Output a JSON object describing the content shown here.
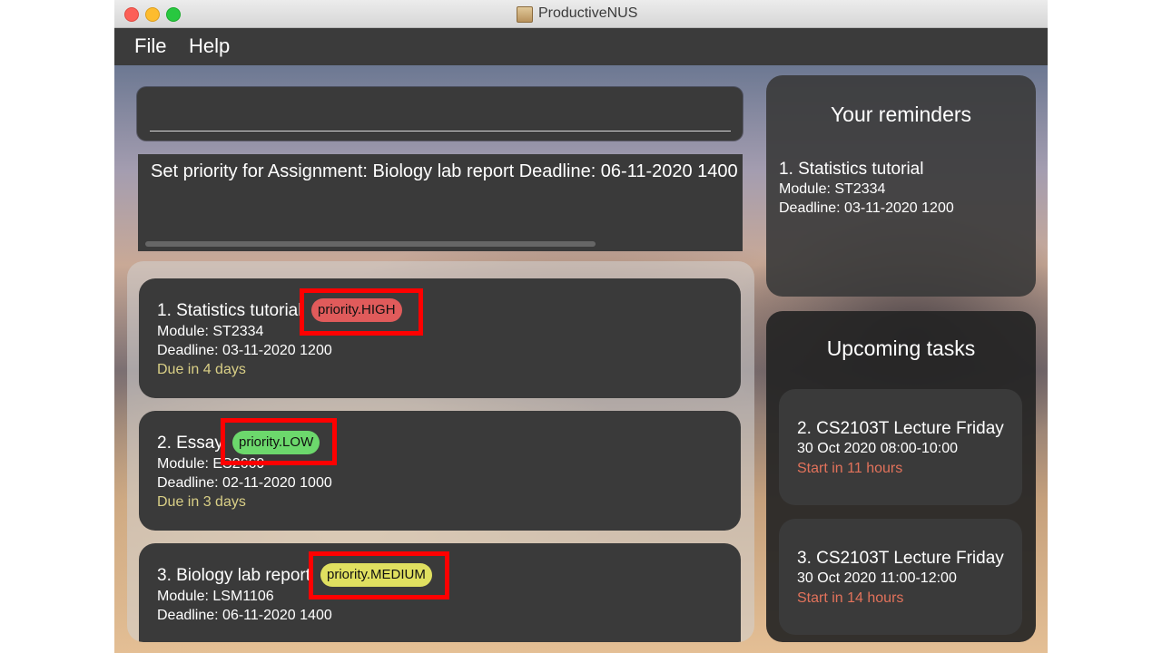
{
  "window": {
    "title": "ProductiveNUS"
  },
  "menu": {
    "file_label": "File",
    "help_label": "Help"
  },
  "command": {
    "value": ""
  },
  "result": {
    "text": "Set priority for Assignment: Biology lab report Deadline: 06-11-2020 1400"
  },
  "tasks": [
    {
      "title": "1.  Statistics tutorial",
      "priority": "priority.HIGH",
      "module": "Module: ST2334",
      "deadline": "Deadline: 03-11-2020 1200",
      "due": "Due in 4 days"
    },
    {
      "title": "2.  Essay",
      "priority": "priority.LOW",
      "module": "Module: ES2660",
      "deadline": "Deadline: 02-11-2020 1000",
      "due": "Due in 3 days"
    },
    {
      "title": "3.  Biology lab report",
      "priority": "priority.MEDIUM",
      "module": "Module: LSM1106",
      "deadline": "Deadline: 06-11-2020 1400",
      "due": ""
    }
  ],
  "reminders": {
    "title": "Your reminders",
    "items": [
      {
        "title": "1.  Statistics tutorial",
        "module": "Module: ST2334",
        "deadline": "Deadline: 03-11-2020 1200"
      }
    ]
  },
  "upcoming": {
    "title": "Upcoming tasks",
    "items": [
      {
        "title": "2.  CS2103T Lecture Friday",
        "time": "30 Oct 2020 08:00-10:00",
        "start": "Start in 11 hours"
      },
      {
        "title": "3.  CS2103T Lecture Friday",
        "time": "30 Oct 2020 11:00-12:00",
        "start": "Start in 14 hours"
      }
    ]
  },
  "colors": {
    "priority_high": "#e05b5b",
    "priority_low": "#6cd86c",
    "priority_medium": "#e0e060",
    "due_text": "#d9cf86",
    "start_text": "#e2725b",
    "highlight_border": "#ff0000"
  }
}
